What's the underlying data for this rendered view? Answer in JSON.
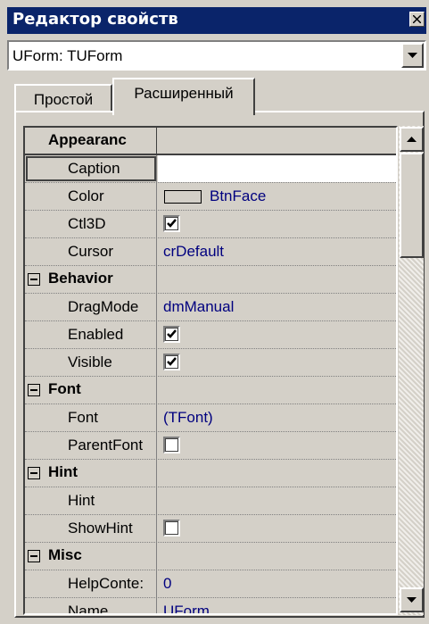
{
  "window": {
    "title": "Редактор свойств"
  },
  "object_selector": {
    "value": "UForm: TUForm"
  },
  "tabs": [
    {
      "label": "Простой",
      "active": false
    },
    {
      "label": "Расширенный",
      "active": true
    }
  ],
  "grid": {
    "header": "Appearanc",
    "rows": {
      "caption": {
        "name": "Caption",
        "value": ""
      },
      "color": {
        "name": "Color",
        "value": "BtnFace"
      },
      "ctl3d": {
        "name": "Ctl3D",
        "checked": true
      },
      "cursor": {
        "name": "Cursor",
        "value": "crDefault"
      },
      "behavior": {
        "name": "Behavior"
      },
      "dragmode": {
        "name": "DragMode",
        "value": "dmManual"
      },
      "enabled": {
        "name": "Enabled",
        "checked": true
      },
      "visible": {
        "name": "Visible",
        "checked": true
      },
      "font_cat": {
        "name": "Font"
      },
      "font": {
        "name": "Font",
        "value": "(TFont)"
      },
      "parentfont": {
        "name": "ParentFont",
        "checked": false
      },
      "hint_cat": {
        "name": "Hint"
      },
      "hint": {
        "name": "Hint",
        "value": ""
      },
      "showhint": {
        "name": "ShowHint",
        "checked": false
      },
      "misc": {
        "name": "Misc"
      },
      "helpcontext": {
        "name": "HelpConte:",
        "value": "0"
      },
      "name": {
        "name": "Name",
        "value": "UForm"
      }
    }
  },
  "colors": {
    "title_bar": "#0a246a",
    "value_text": "#00007f",
    "face": "#d4d0c8"
  }
}
